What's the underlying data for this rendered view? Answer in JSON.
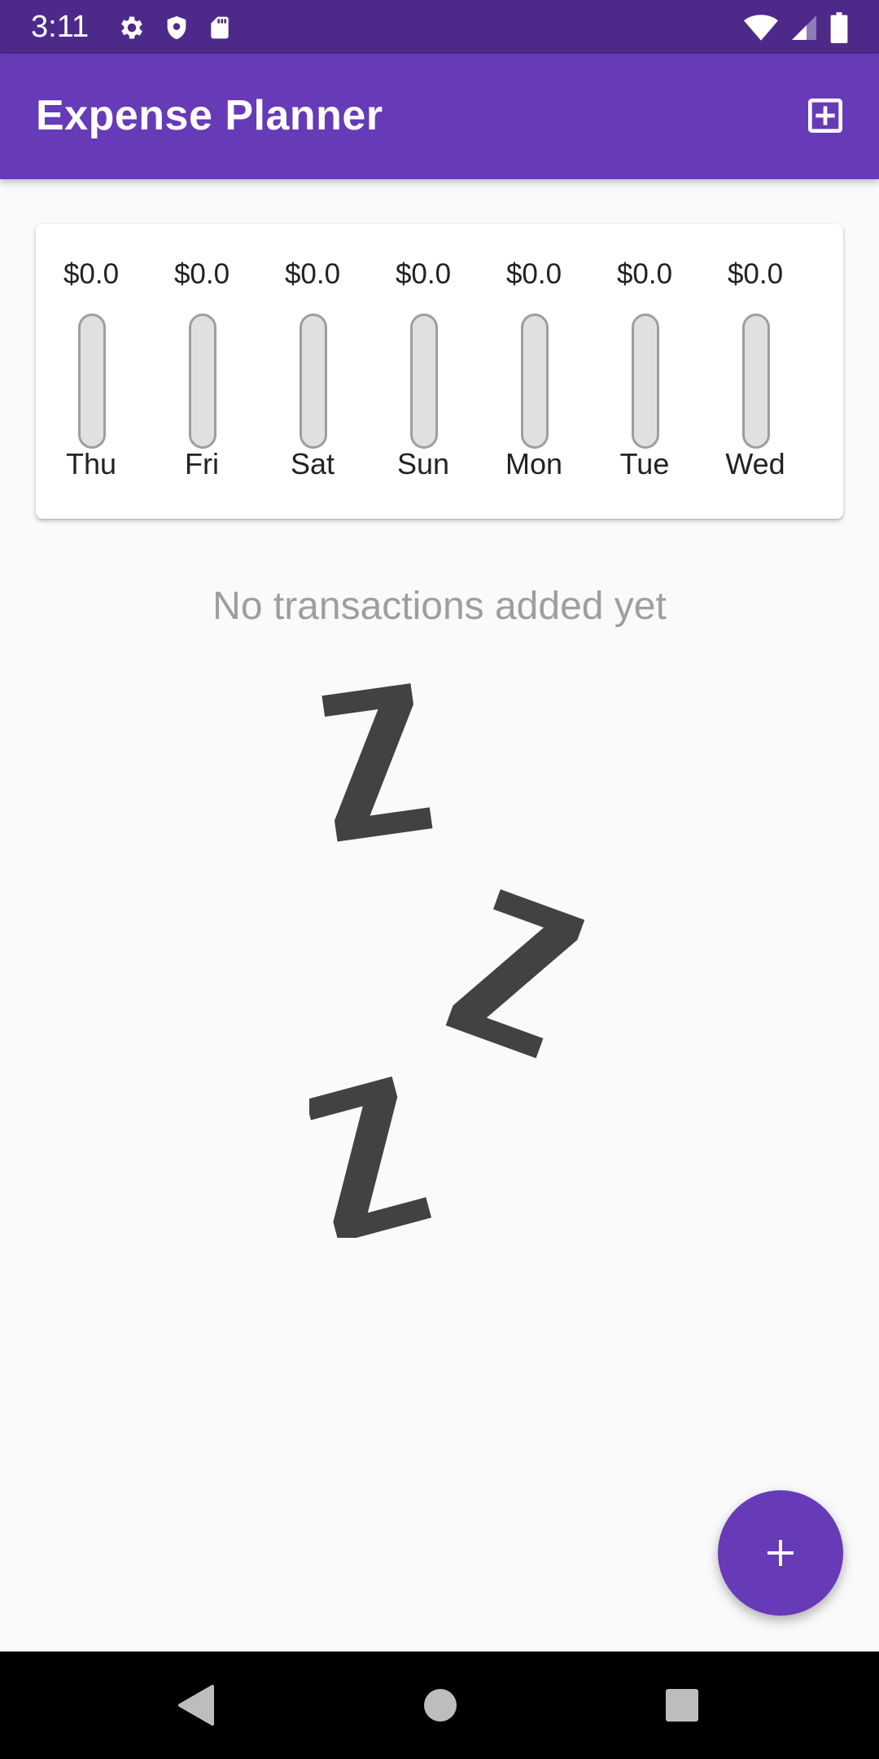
{
  "status_bar": {
    "time": "3:11",
    "left_icons": [
      "gear-icon",
      "shield-icon",
      "sd-card-icon"
    ],
    "right_icons": [
      "wifi-icon",
      "cellular-signal-icon",
      "battery-icon"
    ]
  },
  "app_bar": {
    "title": "Expense Planner",
    "action_icon": "add-box-icon",
    "color": "#673ab7"
  },
  "chart": {
    "bars": [
      {
        "day": "Thu",
        "amount": "$0.0",
        "fill_fraction": 0
      },
      {
        "day": "Fri",
        "amount": "$0.0",
        "fill_fraction": 0
      },
      {
        "day": "Sat",
        "amount": "$0.0",
        "fill_fraction": 0
      },
      {
        "day": "Sun",
        "amount": "$0.0",
        "fill_fraction": 0
      },
      {
        "day": "Mon",
        "amount": "$0.0",
        "fill_fraction": 0
      },
      {
        "day": "Tue",
        "amount": "$0.0",
        "fill_fraction": 0
      },
      {
        "day": "Wed",
        "amount": "$0.0",
        "fill_fraction": 0
      }
    ]
  },
  "empty_state": {
    "message": "No transactions added yet",
    "image": "sleeping-zzz-image"
  },
  "fab": {
    "icon": "plus-icon",
    "color": "#673ab7"
  },
  "nav_bar": {
    "buttons": [
      "back-icon",
      "home-icon",
      "recents-icon"
    ]
  }
}
